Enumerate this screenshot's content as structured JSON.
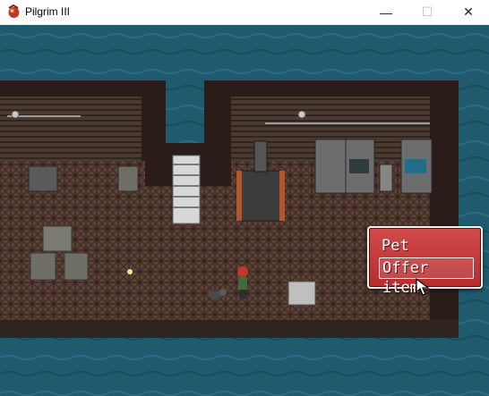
{
  "window": {
    "title": "Pilgrim III",
    "icon": "game-app-icon",
    "controls": {
      "minimize": "—",
      "maximize": "☐",
      "close": "✕"
    }
  },
  "game": {
    "scene": "industrial-interior",
    "colors": {
      "water": "#1f5a6e",
      "wall": "#2b1e1a",
      "floor": "#5a4236",
      "menu_bg": "#c03a3a",
      "menu_border": "#f2f2f2"
    }
  },
  "menu": {
    "items": [
      {
        "label": "Pet",
        "selected": false
      },
      {
        "label": "Offer item",
        "selected": true
      }
    ]
  }
}
